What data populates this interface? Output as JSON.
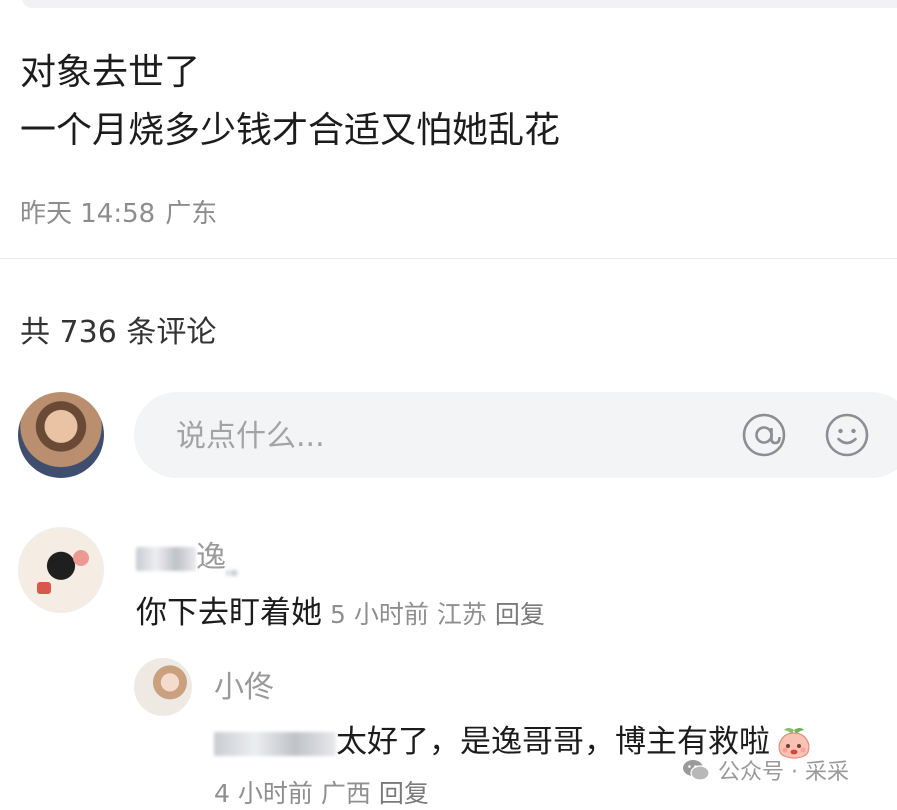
{
  "post": {
    "line1": "对象去世了",
    "line2": "一个月烧多少钱才合适又怕她乱花",
    "time": "昨天 14:58",
    "location": "广东"
  },
  "comments_header": {
    "count_text": "共 736 条评论"
  },
  "comment_box": {
    "placeholder": "说点什么..."
  },
  "comments": [
    {
      "username_visible": "逸",
      "text": "你下去盯着她",
      "time": "5 小时前",
      "location": "江苏",
      "reply_label": "回复"
    },
    {
      "username": "小佟",
      "text_visible": "太好了，是逸哥哥，博主有救啦",
      "time": "4 小时前",
      "location": "广西",
      "reply_label": "回复"
    }
  ],
  "watermark": {
    "text": "公众号 · 采采"
  },
  "colors": {
    "primary_text": "#1c1c1c",
    "secondary_text": "#8d8d8d",
    "input_bg": "#f3f4f6"
  },
  "icons": [
    "at-icon",
    "smiley-icon",
    "peach-emoji-icon",
    "wechat-icon"
  ]
}
